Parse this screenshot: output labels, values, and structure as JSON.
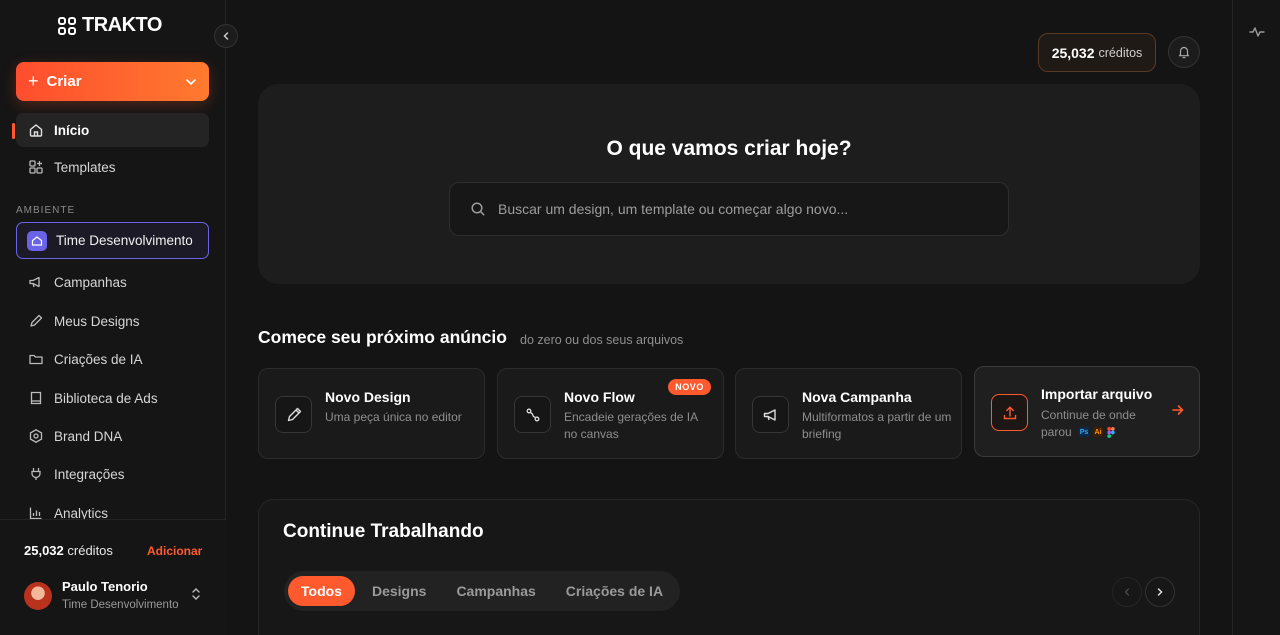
{
  "app": {
    "logo_text": "TRAKTO"
  },
  "sidebar": {
    "create_label": "Criar",
    "nav": [
      {
        "label": "Início",
        "icon": "home-icon",
        "active": true
      },
      {
        "label": "Templates",
        "icon": "templates-icon"
      }
    ],
    "section_label": "AMBIENTE",
    "environment": "Time Desenvolvimento",
    "env_items": [
      {
        "label": "Campanhas",
        "icon": "megaphone-icon"
      },
      {
        "label": "Meus Designs",
        "icon": "pencil-icon"
      },
      {
        "label": "Criações de IA",
        "icon": "folder-icon"
      },
      {
        "label": "Biblioteca de Ads",
        "icon": "book-icon"
      },
      {
        "label": "Brand DNA",
        "icon": "hexagon-icon"
      },
      {
        "label": "Integrações",
        "icon": "plug-icon"
      },
      {
        "label": "Analytics",
        "icon": "bar-chart-icon"
      }
    ],
    "footer": {
      "credits_value": "25,032",
      "credits_label": "créditos",
      "add_label": "Adicionar",
      "user_name": "Paulo Tenorio",
      "user_team": "Time Desenvolvimento"
    }
  },
  "topbar": {
    "credits_value": "25,032",
    "credits_label": "créditos"
  },
  "hero": {
    "title": "O que vamos criar hoje?",
    "search_placeholder": "Buscar um design, um template ou começar algo novo..."
  },
  "start": {
    "title": "Comece seu próximo anúncio",
    "subtitle": "do zero ou dos seus arquivos",
    "cards": [
      {
        "title": "Novo Design",
        "desc": "Uma peça única no editor",
        "icon": "pencil-icon"
      },
      {
        "title": "Novo Flow",
        "desc": "Encadeie gerações de IA no canvas",
        "icon": "flow-icon",
        "badge": "NOVO"
      },
      {
        "title": "Nova Campanha",
        "desc": "Multiformatos a partir de um briefing",
        "icon": "megaphone-icon"
      },
      {
        "title": "Importar arquivo",
        "desc": "Continue de onde parou",
        "icon": "upload-icon",
        "logos": [
          "Ps",
          "Ai",
          "Figma"
        ]
      }
    ]
  },
  "continue": {
    "title": "Continue Trabalhando",
    "tabs": [
      "Todos",
      "Designs",
      "Campanhas",
      "Criações de IA"
    ],
    "active_tab": "Todos"
  },
  "colors": {
    "accent": "#ff5a2e",
    "environment": "#6b63e6",
    "background": "#141414"
  }
}
